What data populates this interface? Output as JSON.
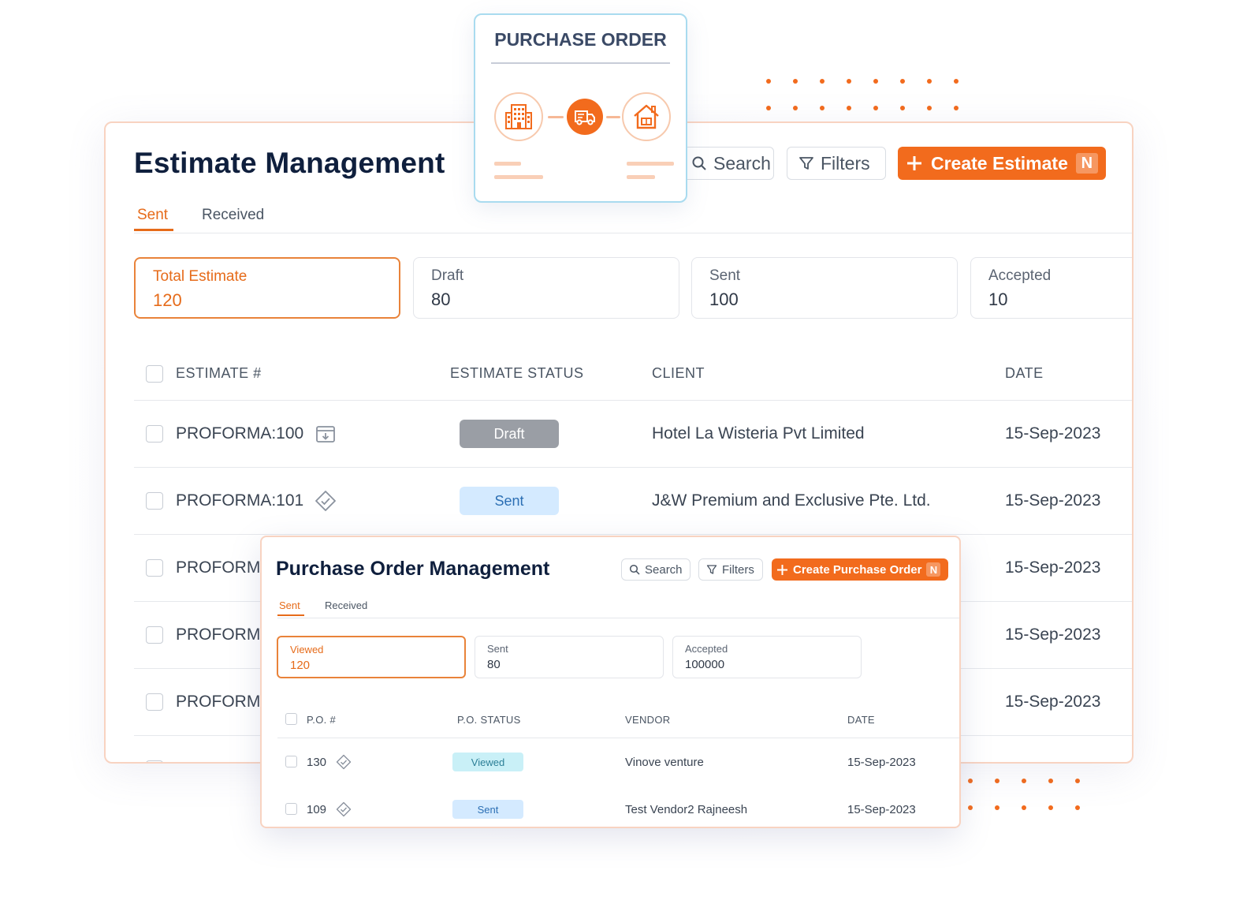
{
  "colors": {
    "accent": "#f26b1d",
    "draft": "#9a9ea5",
    "sent_bg": "#d4eaff",
    "viewed_bg": "#c9f0f7",
    "border_accent": "#f8d3c1"
  },
  "po_card": {
    "title": "PURCHASE ORDER",
    "icons": [
      "building-icon",
      "delivery-truck-icon",
      "house-icon"
    ]
  },
  "estimate": {
    "title": "Estimate Management",
    "search_label": "Search",
    "filters_label": "Filters",
    "create_label": "Create Estimate",
    "create_badge": "N",
    "tabs": [
      "Sent",
      "Received"
    ],
    "active_tab": "Sent",
    "stats": [
      {
        "label": "Total Estimate",
        "value": "120"
      },
      {
        "label": "Draft",
        "value": "80"
      },
      {
        "label": "Sent",
        "value": "100"
      },
      {
        "label": "Accepted",
        "value": "10"
      }
    ],
    "columns": [
      "ESTIMATE #",
      "ESTIMATE STATUS",
      "CLIENT",
      "DATE"
    ],
    "rows": [
      {
        "number": "PROFORMA:100",
        "icon": "download-box-icon",
        "status": "Draft",
        "client": "Hotel La Wisteria Pvt Limited",
        "date": "15-Sep-2023"
      },
      {
        "number": "PROFORMA:101",
        "icon": "verified-badge-icon",
        "status": "Sent",
        "client": "J&W Premium and Exclusive Pte. Ltd.",
        "date": "15-Sep-2023"
      },
      {
        "number": "PROFORMA",
        "date": "15-Sep-2023"
      },
      {
        "number": "PROFORMA",
        "date": "15-Sep-2023"
      },
      {
        "number": "PROFORMA",
        "date": "15-Sep-2023"
      }
    ]
  },
  "purchase_order": {
    "title": "Purchase Order Management",
    "search_label": "Search",
    "filters_label": "Filters",
    "create_label": "Create Purchase Order",
    "create_badge": "N",
    "tabs": [
      "Sent",
      "Received"
    ],
    "active_tab": "Sent",
    "stats": [
      {
        "label": "Viewed",
        "value": "120"
      },
      {
        "label": "Sent",
        "value": "80"
      },
      {
        "label": "Accepted",
        "value": "100000"
      }
    ],
    "columns": [
      "P.O. #",
      "P.O. STATUS",
      "VENDOR",
      "DATE"
    ],
    "rows": [
      {
        "number": "130",
        "status": "Viewed",
        "vendor": "Vinove venture",
        "date": "15-Sep-2023"
      },
      {
        "number": "109",
        "status": "Sent",
        "vendor": "Test Vendor2 Rajneesh",
        "date": "15-Sep-2023"
      }
    ]
  }
}
